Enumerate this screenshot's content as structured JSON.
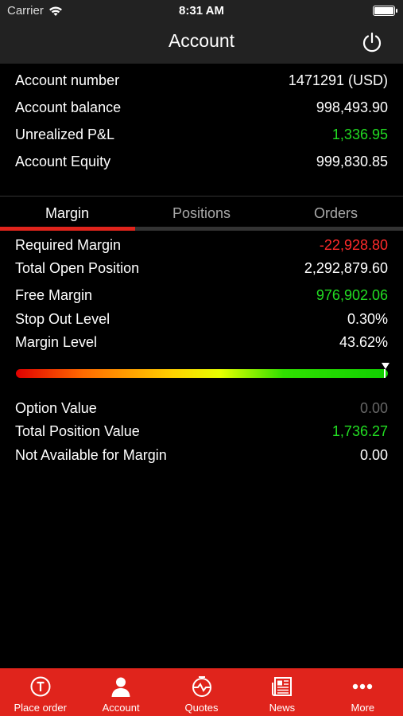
{
  "status_bar": {
    "carrier": "Carrier",
    "time": "8:31 AM",
    "icons": [
      "wifi-icon",
      "battery-icon"
    ]
  },
  "header": {
    "title": "Account",
    "power_icon": "power-icon"
  },
  "summary": [
    {
      "label": "Account number",
      "value": "1471291 (USD)",
      "color": "#ffffff"
    },
    {
      "label": "Account balance",
      "value": "998,493.90",
      "color": "#ffffff"
    },
    {
      "label": "Unrealized P&L",
      "value": "1,336.95",
      "color": "#22dd22"
    },
    {
      "label": "Account Equity",
      "value": "999,830.85",
      "color": "#ffffff"
    }
  ],
  "tabs": [
    {
      "label": "Margin",
      "active": true
    },
    {
      "label": "Positions",
      "active": false
    },
    {
      "label": "Orders",
      "active": false
    }
  ],
  "margin": [
    {
      "label": "Required Margin",
      "value": "-22,928.80",
      "color": "#ff2a2a"
    },
    {
      "label": "Total Open Position",
      "value": "2,292,879.60",
      "color": "#ffffff"
    },
    {
      "label": "Free Margin",
      "value": "976,902.06",
      "color": "#22dd22"
    },
    {
      "label": "Stop Out Level",
      "value": "0.30%",
      "color": "#ffffff"
    },
    {
      "label": "Margin Level",
      "value": "43.62%",
      "color": "#ffffff"
    }
  ],
  "margin_level_indicator": {
    "position_fraction": 1.0
  },
  "values": [
    {
      "label": "Option Value",
      "value": "0.00",
      "color": "#666666"
    },
    {
      "label": "Total Position Value",
      "value": "1,736.27",
      "color": "#22dd22"
    },
    {
      "label": "Not Available for Margin",
      "value": "0.00",
      "color": "#ffffff"
    }
  ],
  "bottom_nav": [
    {
      "label": "Place order",
      "icon": "place-order-icon"
    },
    {
      "label": "Account",
      "icon": "account-icon"
    },
    {
      "label": "Quotes",
      "icon": "quotes-icon"
    },
    {
      "label": "News",
      "icon": "news-icon"
    },
    {
      "label": "More",
      "icon": "more-icon"
    }
  ],
  "colors": {
    "accent": "#e0241c",
    "positive": "#22dd22",
    "negative": "#ff2a2a",
    "bar_background": "#222222"
  }
}
